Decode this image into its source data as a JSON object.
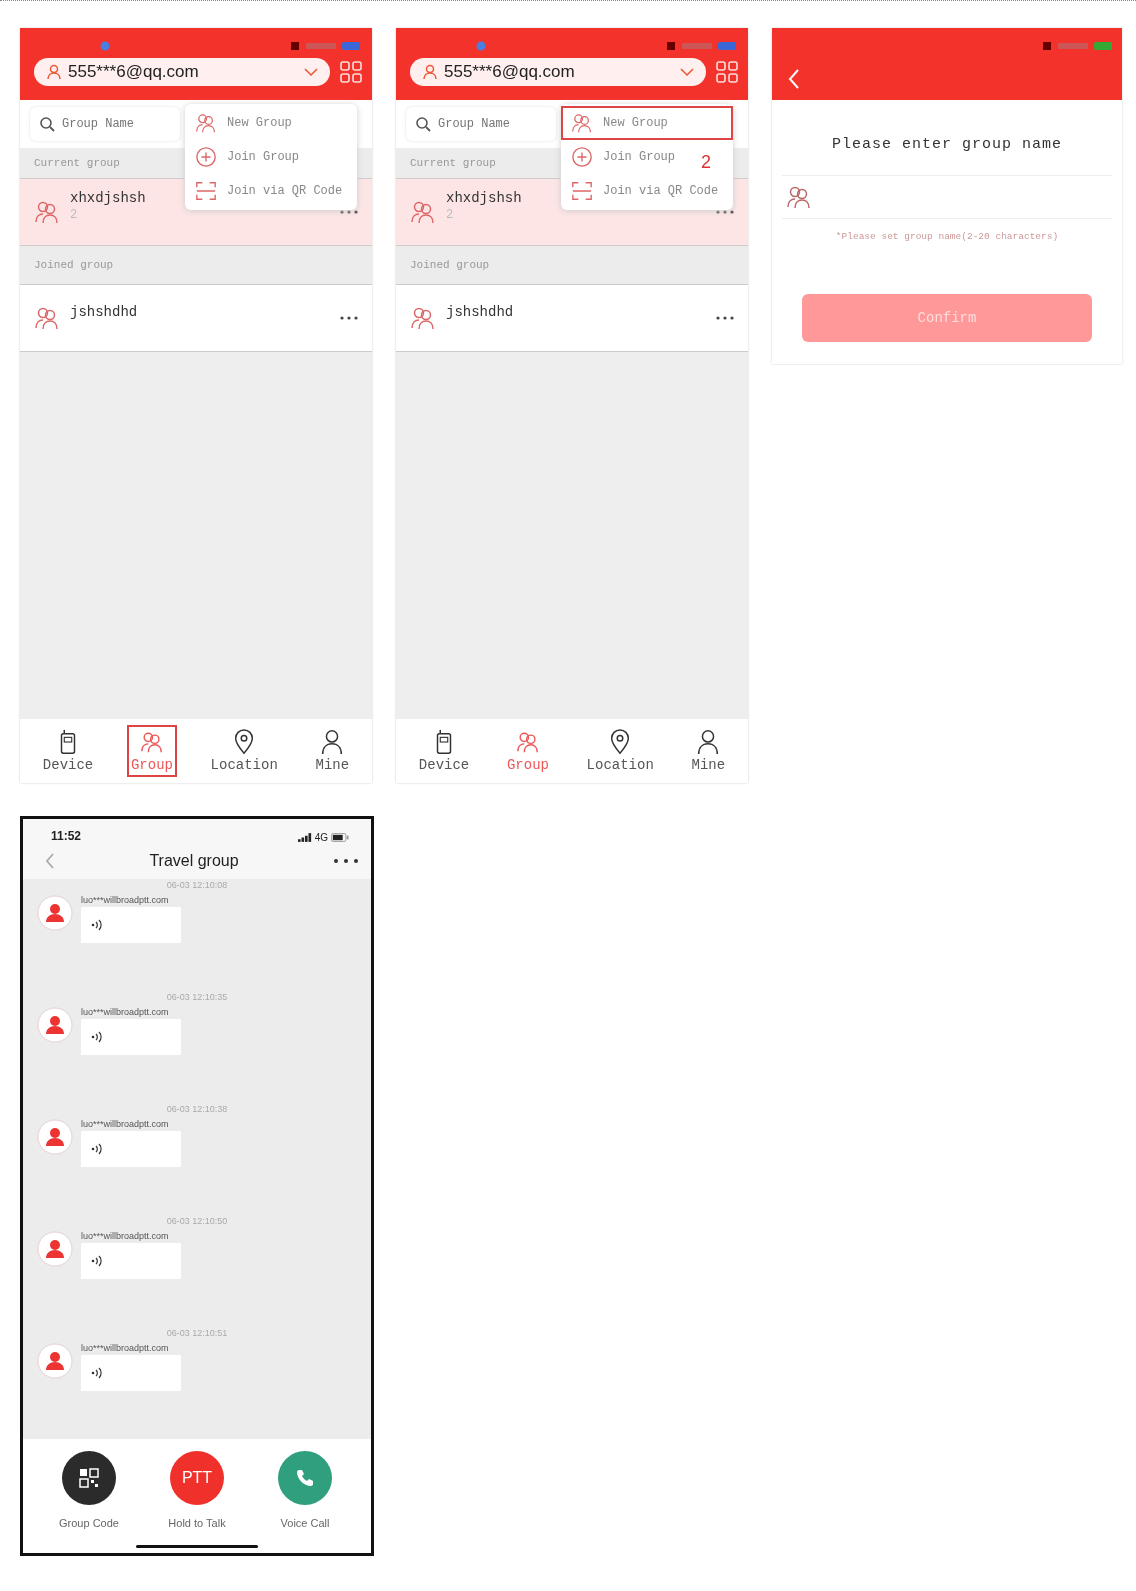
{
  "group_screens": [
    {
      "account": "555***6@qq.com",
      "search_placeholder": "Group Name",
      "current_label": "Current group",
      "current_group": {
        "name": "xhxdjshsh",
        "members": "2"
      },
      "joined_label": "Joined group",
      "joined_groups": [
        {
          "name": "jshshdhd"
        }
      ],
      "menu": [
        {
          "kind": "new",
          "label": "New Group",
          "boxed": false
        },
        {
          "kind": "join",
          "label": "Join Group",
          "boxed": false
        },
        {
          "kind": "qr",
          "label": "Join via QR Code",
          "boxed": false
        }
      ],
      "nav": [
        {
          "kind": "device",
          "label": "Device",
          "selected": false,
          "boxed": false
        },
        {
          "kind": "group",
          "label": "Group",
          "selected": true,
          "boxed": true
        },
        {
          "kind": "location",
          "label": "Location",
          "selected": false,
          "boxed": false
        },
        {
          "kind": "mine",
          "label": "Mine",
          "selected": false,
          "boxed": false
        }
      ]
    },
    {
      "account": "555***6@qq.com",
      "search_placeholder": "Group Name",
      "current_label": "Current group",
      "current_group": {
        "name": "xhxdjshsh",
        "members": "2"
      },
      "joined_label": "Joined group",
      "joined_groups": [
        {
          "name": "jshshdhd"
        }
      ],
      "menu": [
        {
          "kind": "new",
          "label": "New Group",
          "boxed": true
        },
        {
          "kind": "join",
          "label": "Join Group",
          "boxed": false
        },
        {
          "kind": "qr",
          "label": "Join via QR Code",
          "boxed": false
        }
      ],
      "step_marker": "2",
      "nav": [
        {
          "kind": "device",
          "label": "Device",
          "selected": false,
          "boxed": false
        },
        {
          "kind": "group",
          "label": "Group",
          "selected": true,
          "boxed": false
        },
        {
          "kind": "location",
          "label": "Location",
          "selected": false,
          "boxed": false
        },
        {
          "kind": "mine",
          "label": "Mine",
          "selected": false,
          "boxed": false
        }
      ]
    }
  ],
  "new_group_screen": {
    "title": "Please enter group name",
    "hint": "*Please set group name(2-20 characters)",
    "confirm": "Confirm",
    "confirm_disabled": true
  },
  "chat_screen": {
    "time": "11:52",
    "network": "4G",
    "title": "Travel group",
    "messages": [
      {
        "time": "06-03 12:10:08",
        "sender": "luo***willbroadptt.com"
      },
      {
        "time": "06-03 12:10:35",
        "sender": "luo***willbroadptt.com"
      },
      {
        "time": "06-03 12:10:38",
        "sender": "luo***willbroadptt.com"
      },
      {
        "time": "06-03 12:10:50",
        "sender": "luo***willbroadptt.com"
      },
      {
        "time": "06-03 12:10:51",
        "sender": "luo***willbroadptt.com"
      }
    ],
    "actions": [
      {
        "kind": "qr",
        "label": "Group Code"
      },
      {
        "kind": "ptt",
        "label": "Hold to Talk",
        "text": "PTT"
      },
      {
        "kind": "call",
        "label": "Voice Call"
      }
    ]
  }
}
